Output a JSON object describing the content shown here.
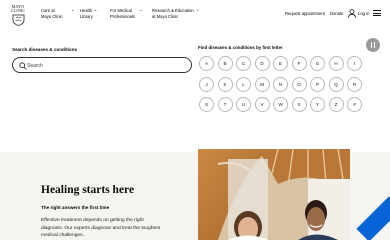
{
  "header": {
    "logo_text": "MAYO CLINIC",
    "nav": [
      {
        "line1": "Care at",
        "line2": "Mayo Clinic"
      },
      {
        "line1": "Health",
        "line2": "Library"
      },
      {
        "line1": "For Medical",
        "line2": "Professionals"
      },
      {
        "line1": "Research & Education",
        "line2": "at Mayo Clinic"
      }
    ],
    "request_appointment": "Request appointment",
    "donate": "Donate",
    "log_in": "Log in"
  },
  "search": {
    "label": "Search diseases & conditions",
    "placeholder": "Search"
  },
  "letters": {
    "label": "Find diseases & conditions by first letter",
    "items": [
      "A",
      "B",
      "C",
      "D",
      "E",
      "F",
      "G",
      "H",
      "I",
      "J",
      "K",
      "L",
      "M",
      "N",
      "O",
      "P",
      "Q",
      "R",
      "S",
      "T",
      "U",
      "V",
      "W",
      "X",
      "Y",
      "Z",
      "#"
    ]
  },
  "hero": {
    "title": "Healing starts here",
    "subtitle": "The right answers the first time",
    "body": "Effective treatment depends on getting the right diagnosis. Our experts diagnose and treat the toughest medical challenges."
  },
  "colors": {
    "accent_blue": "#0a64d8",
    "hero_bg": "#f6f4f1",
    "pause_button": "#9a9a9a"
  },
  "icons": [
    "shield-logo-icon",
    "chevron-down-icon",
    "user-icon",
    "menu-icon",
    "search-icon",
    "pause-icon"
  ]
}
